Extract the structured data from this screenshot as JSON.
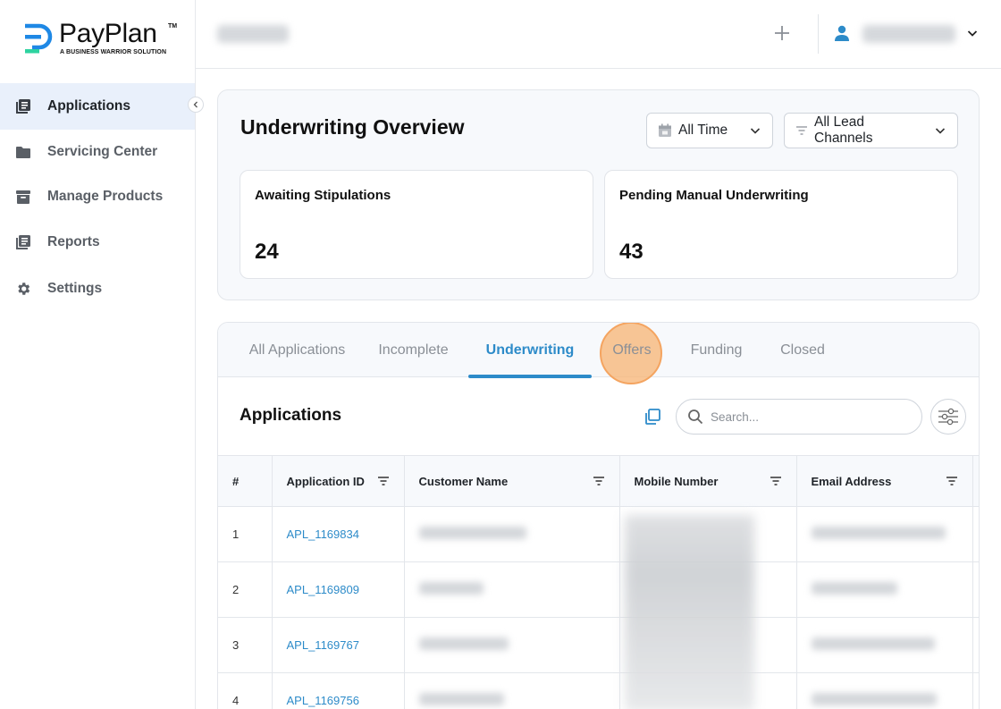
{
  "brand": {
    "name": "PayPlan",
    "trademark": "TM",
    "tagline": "A BUSINESS WARRIOR SOLUTION",
    "colors": {
      "primary": "#2d8bc9",
      "logo_blue": "#1e88e5",
      "logo_green": "#2ed3a0"
    }
  },
  "sidebar": {
    "items": [
      {
        "label": "Applications",
        "icon": "applications-icon",
        "active": true
      },
      {
        "label": "Servicing Center",
        "icon": "folder-icon",
        "active": false
      },
      {
        "label": "Manage Products",
        "icon": "archive-icon",
        "active": false
      },
      {
        "label": "Reports",
        "icon": "reports-icon",
        "active": false
      },
      {
        "label": "Settings",
        "icon": "gear-icon",
        "active": false
      }
    ]
  },
  "header": {
    "plus_icon": "plus-icon",
    "user_icon": "user-icon"
  },
  "overview": {
    "title": "Underwriting Overview",
    "time_filter": "All Time",
    "channel_filter": "All Lead Channels",
    "stats": [
      {
        "label": "Awaiting Stipulations",
        "value": "24"
      },
      {
        "label": "Pending Manual Underwriting",
        "value": "43"
      }
    ]
  },
  "tabs": [
    {
      "label": "All Applications"
    },
    {
      "label": "Incomplete"
    },
    {
      "label": "Underwriting",
      "active": true
    },
    {
      "label": "Offers"
    },
    {
      "label": "Funding"
    },
    {
      "label": "Closed"
    }
  ],
  "applications": {
    "title": "Applications",
    "search_placeholder": "Search...",
    "columns": [
      "#",
      "Application ID",
      "Customer Name",
      "Mobile Number",
      "Email Address"
    ],
    "rows": [
      {
        "num": "1",
        "id": "APL_1169834"
      },
      {
        "num": "2",
        "id": "APL_1169809"
      },
      {
        "num": "3",
        "id": "APL_1169767"
      },
      {
        "num": "4",
        "id": "APL_1169756"
      }
    ]
  }
}
